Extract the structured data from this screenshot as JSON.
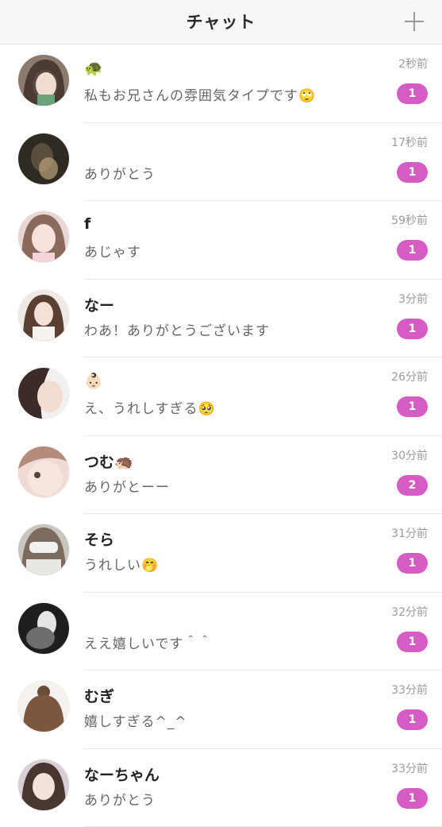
{
  "header": {
    "title": "チャット",
    "add_icon": "plus-icon"
  },
  "colors": {
    "badge": "#d45cc3",
    "header_bg": "#f7f7f7",
    "time_text": "#9b9b9b"
  },
  "chats": [
    {
      "name": "🐢",
      "preview": "私もお兄さんの雰囲気タイプです🙄",
      "time": "2秒前",
      "unread": "1"
    },
    {
      "name": "",
      "preview": "ありがとう",
      "time": "17秒前",
      "unread": "1"
    },
    {
      "name": "f",
      "preview": "あじゃす",
      "time": "59秒前",
      "unread": "1"
    },
    {
      "name": "なー",
      "preview": "わあ！ありがとうございます",
      "time": "3分前",
      "unread": "1"
    },
    {
      "name": "👶🏻",
      "preview": "え、うれしすぎる🥺",
      "time": "26分前",
      "unread": "1"
    },
    {
      "name": "つむ🦔",
      "preview": "ありがとーー",
      "time": "30分前",
      "unread": "2"
    },
    {
      "name": "そら",
      "preview": "うれしい🤭",
      "time": "31分前",
      "unread": "1"
    },
    {
      "name": "",
      "preview": "ええ嬉しいです＾＾",
      "time": "32分前",
      "unread": "1"
    },
    {
      "name": "むぎ",
      "preview": "嬉しすぎる^_^",
      "time": "33分前",
      "unread": "1"
    },
    {
      "name": "なーちゃん",
      "preview": "ありがとう",
      "time": "33分前",
      "unread": "1"
    }
  ]
}
